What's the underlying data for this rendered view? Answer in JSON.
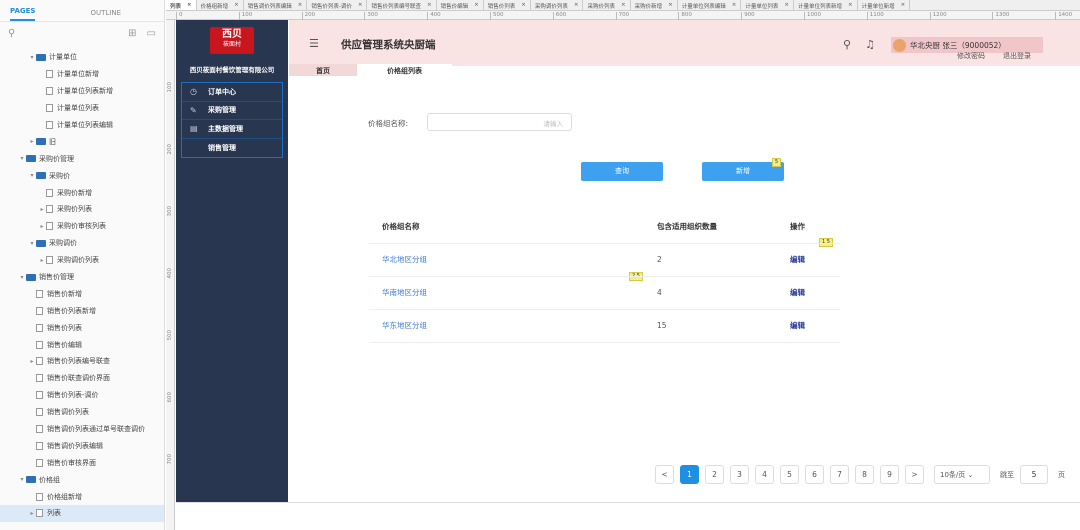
{
  "left_panel": {
    "tabs": [
      "PAGES",
      "OUTLINE"
    ],
    "tree": [
      {
        "label": "计量单位",
        "type": "folder",
        "indent": 2,
        "arrow": "▾"
      },
      {
        "label": "计量单位新增",
        "type": "page",
        "indent": 3,
        "arrow": ""
      },
      {
        "label": "计量单位列表新增",
        "type": "page",
        "indent": 3,
        "arrow": ""
      },
      {
        "label": "计量单位列表",
        "type": "page",
        "indent": 3,
        "arrow": ""
      },
      {
        "label": "计量单位列表编辑",
        "type": "page",
        "indent": 3,
        "arrow": ""
      },
      {
        "label": "旧",
        "type": "folder",
        "indent": 2,
        "arrow": "▸"
      },
      {
        "label": "采购价管理",
        "type": "folder",
        "indent": 1,
        "arrow": "▾"
      },
      {
        "label": "采购价",
        "type": "folder",
        "indent": 2,
        "arrow": "▾"
      },
      {
        "label": "采购价新增",
        "type": "page",
        "indent": 3,
        "arrow": ""
      },
      {
        "label": "采购价列表",
        "type": "page",
        "indent": 3,
        "arrow": "▸"
      },
      {
        "label": "采购价审核列表",
        "type": "page",
        "indent": 3,
        "arrow": "▸"
      },
      {
        "label": "采购调价",
        "type": "folder",
        "indent": 2,
        "arrow": "▾"
      },
      {
        "label": "采购调价列表",
        "type": "page",
        "indent": 3,
        "arrow": "▸"
      },
      {
        "label": "销售价管理",
        "type": "folder",
        "indent": 1,
        "arrow": "▾"
      },
      {
        "label": "销售价新增",
        "type": "page",
        "indent": 2,
        "arrow": ""
      },
      {
        "label": "销售价列表新增",
        "type": "page",
        "indent": 2,
        "arrow": ""
      },
      {
        "label": "销售价列表",
        "type": "page",
        "indent": 2,
        "arrow": ""
      },
      {
        "label": "销售价编辑",
        "type": "page",
        "indent": 2,
        "arrow": ""
      },
      {
        "label": "销售价列表编号联查",
        "type": "page",
        "indent": 2,
        "arrow": "▸"
      },
      {
        "label": "销售价联查调价界面",
        "type": "page",
        "indent": 2,
        "arrow": ""
      },
      {
        "label": "销售价列表-调价",
        "type": "page",
        "indent": 2,
        "arrow": ""
      },
      {
        "label": "销售调价列表",
        "type": "page",
        "indent": 2,
        "arrow": ""
      },
      {
        "label": "销售调价列表通过单号联查调价",
        "type": "page",
        "indent": 2,
        "arrow": ""
      },
      {
        "label": "销售调价列表编辑",
        "type": "page",
        "indent": 2,
        "arrow": ""
      },
      {
        "label": "销售价审核界面",
        "type": "page",
        "indent": 2,
        "arrow": ""
      },
      {
        "label": "价格组",
        "type": "folder",
        "indent": 1,
        "arrow": "▾"
      },
      {
        "label": "价格组新增",
        "type": "page",
        "indent": 2,
        "arrow": ""
      },
      {
        "label": "列表",
        "type": "page",
        "indent": 2,
        "arrow": "▸",
        "selected": true
      }
    ]
  },
  "page_tabs": [
    "列表",
    "价格组新增",
    "销售调价列表编辑",
    "销售价列表-调价",
    "销售价列表编号联查",
    "销售价编辑",
    "销售价列表",
    "采购调价列表",
    "采购价列表",
    "采购价新增",
    "计量单位列表编辑",
    "计量单位列表",
    "计量单位列表新增",
    "计量单位新增"
  ],
  "ruler_top": [
    "0",
    "100",
    "200",
    "300",
    "400",
    "500",
    "600",
    "700",
    "800",
    "900",
    "1000",
    "1100",
    "1200",
    "1300",
    "1400"
  ],
  "ruler_left": [
    "100",
    "200",
    "300",
    "400",
    "500",
    "600",
    "700"
  ],
  "app": {
    "logo_main": "西贝",
    "logo_sub": "莜面村",
    "company": "西贝莜面村餐饮管理有限公司",
    "menu": [
      {
        "icon": "◷",
        "label": "订单中心"
      },
      {
        "icon": "✎",
        "label": "采购管理"
      },
      {
        "icon": "▤",
        "label": "主数据管理"
      },
      {
        "icon": "",
        "label": "销售管理"
      }
    ],
    "title": "供应管理系统央厨端",
    "user": "华北央厨 张三（9000052）",
    "links": [
      "修改密码",
      "退出登录"
    ],
    "tabs": [
      "首页",
      "价格组列表"
    ]
  },
  "form": {
    "label": "价格组名称:",
    "placeholder": "请输入",
    "query_button": "查询",
    "add_button": "新增"
  },
  "table": {
    "headers": [
      "价格组名称",
      "包含适用组织数量",
      "操作"
    ],
    "rows": [
      {
        "name": "华北地区分组",
        "count": "2",
        "action": "编辑"
      },
      {
        "name": "华南地区分组",
        "count": "4",
        "action": "编辑"
      },
      {
        "name": "华东地区分组",
        "count": "15",
        "action": "编辑"
      }
    ]
  },
  "badges": [
    "5",
    "1",
    "5",
    "2",
    "5"
  ],
  "pagination": {
    "prev": "<",
    "pages": [
      "1",
      "2",
      "3",
      "4",
      "5",
      "6",
      "7",
      "8",
      "9"
    ],
    "next": ">",
    "page_size": "10条/页",
    "jump_label": "跳至",
    "jump_value": "5",
    "jump_suffix": "页"
  }
}
